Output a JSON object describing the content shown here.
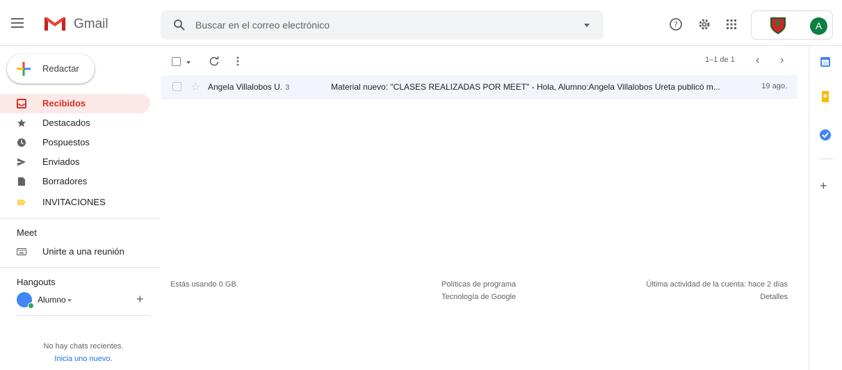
{
  "header": {
    "app_name": "Gmail",
    "search_placeholder": "Buscar en el correo electrónico",
    "avatar_letter": "A",
    "icons": [
      "menu-icon",
      "gmail-logo",
      "search-icon",
      "help-icon",
      "settings-icon",
      "apps-icon"
    ]
  },
  "sidebar": {
    "compose_label": "Redactar",
    "items": [
      {
        "label": "Recibidos",
        "icon": "inbox-icon",
        "active": true
      },
      {
        "label": "Destacados",
        "icon": "star-icon"
      },
      {
        "label": "Pospuestos",
        "icon": "clock-icon"
      },
      {
        "label": "Enviados",
        "icon": "send-icon"
      },
      {
        "label": "Borradores",
        "icon": "draft-icon"
      },
      {
        "label": "INVITACIONES",
        "icon": "label-icon"
      }
    ],
    "meet_title": "Meet",
    "meet_join": "Unirte a una reunión",
    "hangouts_title": "Hangouts",
    "hangouts_user": "Alumno",
    "no_chats": "No hay chats recientes.",
    "start_new": "Inicia uno nuevo."
  },
  "toolbar": {
    "pagination": "1–1 de 1"
  },
  "mail": {
    "sender": "Angela Villalobos U.",
    "count": "3",
    "subject": "Material nuevo: \"CLASES REALIZADAS POR MEET\" - Hola, Alumno:Angela Villalobos Ureta publicó m...",
    "date": "19 ago."
  },
  "footer": {
    "storage": "Estás usando 0 GB.",
    "policies": "Políticas de programa",
    "tech": "Tecnología de Google",
    "last_activity": "Última actividad de la cuenta: hace 2 días",
    "details": "Detalles"
  },
  "colors": {
    "active_bg": "#fce8e6",
    "active_text": "#d93025",
    "row_bg": "#f2f6fc",
    "avatar_bg": "#0b8043",
    "link": "#1a73e8"
  }
}
